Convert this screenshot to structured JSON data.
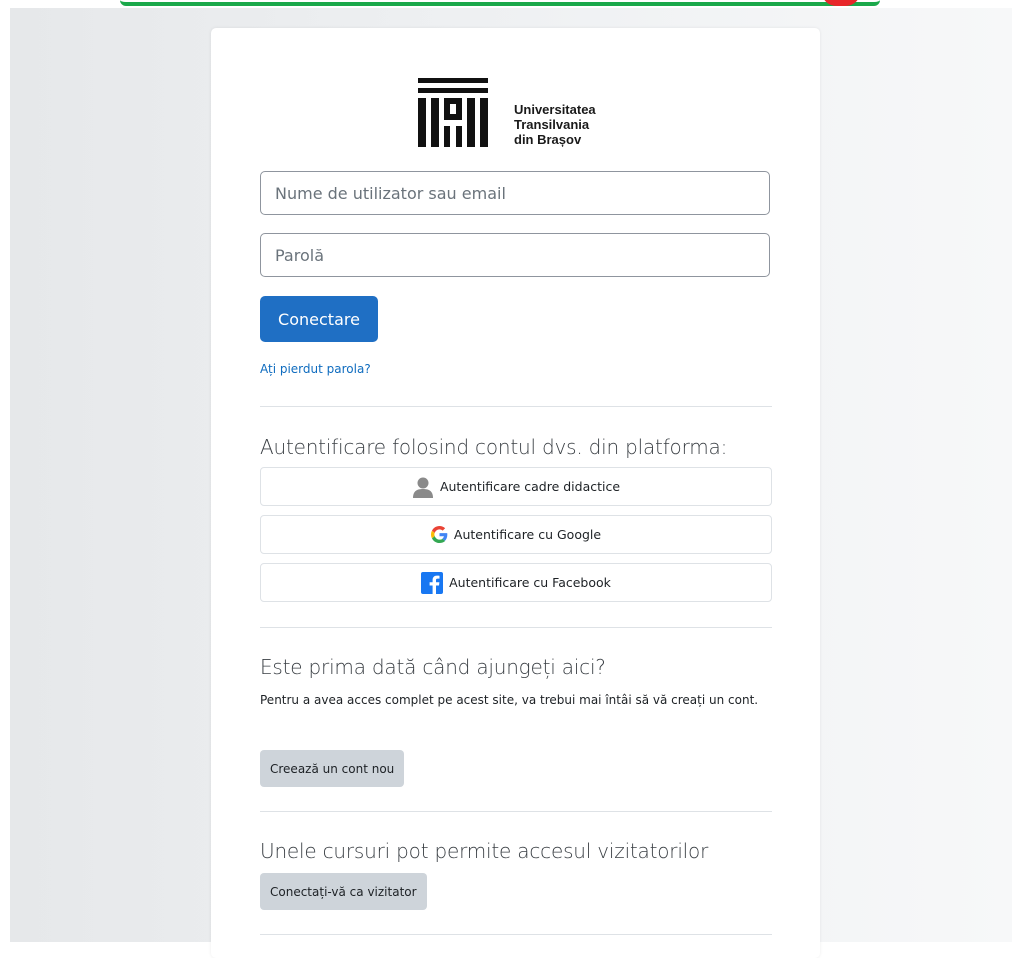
{
  "brand": {
    "line1": "Universitatea",
    "line2": "Transilvania",
    "line3": "din Brașov"
  },
  "login": {
    "username_placeholder": "Nume de utilizator sau email",
    "password_placeholder": "Parolă",
    "submit_label": "Conectare",
    "forgot_link": "Ați pierdut parola?"
  },
  "identity_providers": {
    "heading": "Autentificare folosind contul dvs. din platforma:",
    "buttons": [
      {
        "label": "Autentificare cadre didactice",
        "icon": "user-icon"
      },
      {
        "label": "Autentificare cu Google",
        "icon": "google-icon"
      },
      {
        "label": "Autentificare cu Facebook",
        "icon": "facebook-icon"
      }
    ]
  },
  "signup": {
    "heading": "Este prima dată când ajungeți aici?",
    "text": "Pentru a avea acces complet pe acest site, va trebui mai întâi să vă creați un cont.",
    "button_label": "Creează un cont nou"
  },
  "guest": {
    "heading": "Unele cursuri pot permite accesul vizitatorilor",
    "button_label": "Conectați-vă ca vizitator"
  },
  "colors": {
    "primary": "#1f6fc4",
    "link": "#0f6cbf",
    "secondary": "#ced4da",
    "google_blue": "#4285f4",
    "facebook_blue": "#1877f2"
  }
}
